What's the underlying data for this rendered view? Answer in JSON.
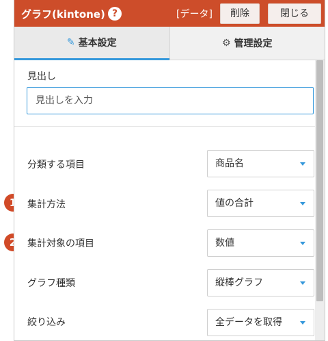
{
  "header": {
    "title": "グラフ(kintone)",
    "help_icon": "?",
    "data_label": "[データ]",
    "delete_label": "削除",
    "close_label": "閉じる",
    "color": "#cd4d2a"
  },
  "tabs": [
    {
      "label": "基本設定",
      "icon": "pencil-square-icon",
      "active": true
    },
    {
      "label": "管理設定",
      "icon": "gear-icon",
      "active": false
    }
  ],
  "heading": {
    "label": "見出し",
    "placeholder": "見出しを入力",
    "value": ""
  },
  "fields": [
    {
      "label": "分類する項目",
      "value": "商品名",
      "badge": ""
    },
    {
      "label": "集計方法",
      "value": "値の合計",
      "badge": "1"
    },
    {
      "label": "集計対象の項目",
      "value": "数値",
      "badge": "2"
    },
    {
      "label": "グラフ種類",
      "value": "縦棒グラフ",
      "badge": ""
    },
    {
      "label": "絞り込み",
      "value": "全データを取得",
      "badge": ""
    }
  ],
  "accent": "#3598db"
}
